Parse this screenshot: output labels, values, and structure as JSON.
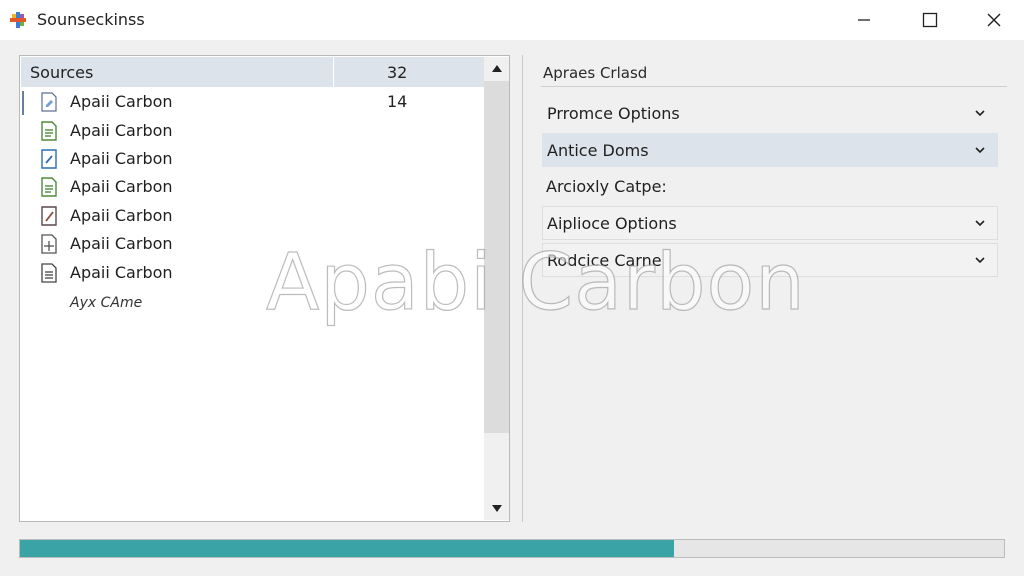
{
  "window": {
    "title": "Sounseckinss",
    "controls": [
      "minimize-icon",
      "maximize-icon",
      "close-icon"
    ]
  },
  "sources": {
    "header": {
      "name": "Sources",
      "count": "32"
    },
    "items": [
      {
        "label": "Apaii Carbon",
        "count": "14",
        "icon": "document-edit-icon",
        "selected": true
      },
      {
        "label": "Apaii Carbon",
        "count": "",
        "icon": "document-green-icon",
        "selected": false
      },
      {
        "label": "Apaii Carbon",
        "count": "",
        "icon": "document-blue-icon",
        "selected": false
      },
      {
        "label": "Apaii  Carbon",
        "count": "",
        "icon": "document-green-icon",
        "selected": false
      },
      {
        "label": "Apaii Carbon",
        "count": "",
        "icon": "document-pen-icon",
        "selected": false
      },
      {
        "label": "Apaii Carbon",
        "count": "",
        "icon": "document-plus-icon",
        "selected": false
      },
      {
        "label": "Apaii Carbon",
        "count": "",
        "icon": "document-text-icon",
        "selected": false
      }
    ],
    "extra_label": "Ayx CAme"
  },
  "options_panel": {
    "section_title": "Apraes Crlasd",
    "dropdown_1": "Prromce Options",
    "dropdown_2": "Antice Doms",
    "static_label": "Arcioxly Catpe:",
    "dropdown_3": "Aiplioce Options",
    "dropdown_4": "Rodcice Carne"
  },
  "watermark": "Apabi Carbon",
  "progress": {
    "fraction": 0.665,
    "color": "#3aa3a6"
  },
  "colors": {
    "selection": "#dde3ea",
    "accent": "#3aa3a6"
  }
}
